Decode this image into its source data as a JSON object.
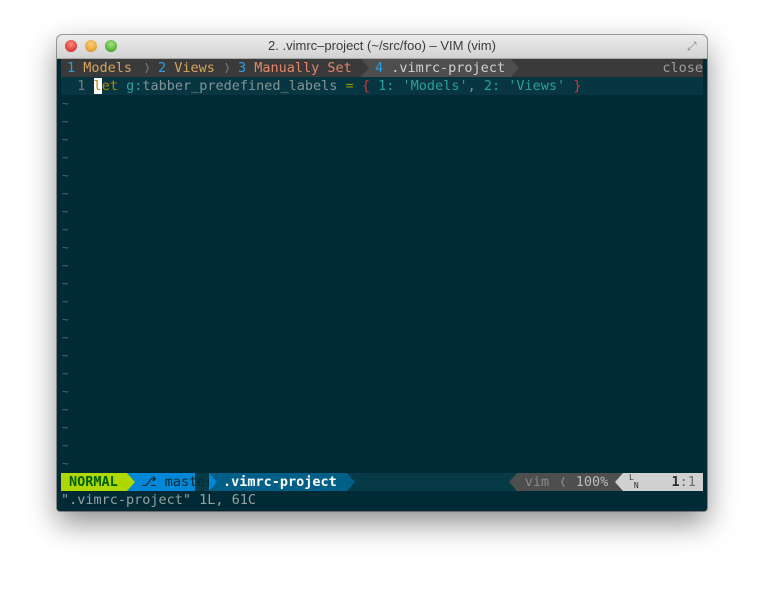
{
  "window": {
    "title": "2. .vimrc–project (~/src/foo) – VIM (vim)",
    "buttons": [
      "close",
      "minimize",
      "maximize"
    ]
  },
  "tabline": {
    "tabs": [
      {
        "num": "1",
        "label": "Models"
      },
      {
        "num": "2",
        "label": "Views"
      },
      {
        "num": "3",
        "label": "Manually Set"
      },
      {
        "num": "4",
        "label": ".vimrc-project",
        "active": true
      }
    ],
    "separator": "〉",
    "close_label": "close"
  },
  "buffer": {
    "line_number": "1",
    "cursor_char": "l",
    "tokens": {
      "kw_rest": "et",
      "scope": "g:",
      "name": "tabber_predefined_labels",
      "eq": "=",
      "open_brace": "{",
      "k1": "1:",
      "v1": "'Models'",
      "comma": ",",
      "k2": "2:",
      "v2": "'Views'",
      "close_brace": "}"
    },
    "tilde_glyph": "~",
    "tilde_count": 21
  },
  "statusline": {
    "mode": "NORMAL",
    "branch_icon": "⎇",
    "branch": "master",
    "filename": ".vimrc-project",
    "filetype": "vim",
    "percent": "100%",
    "ln_icon": "LN",
    "line": "1",
    "col": "1"
  },
  "cmdline": {
    "message": "\".vimrc-project\" 1L, 61C"
  },
  "colors": {
    "background": "#002b36",
    "mode_bg": "#afd700",
    "branch_bg": "#0087d7",
    "file_bg": "#005f87"
  }
}
